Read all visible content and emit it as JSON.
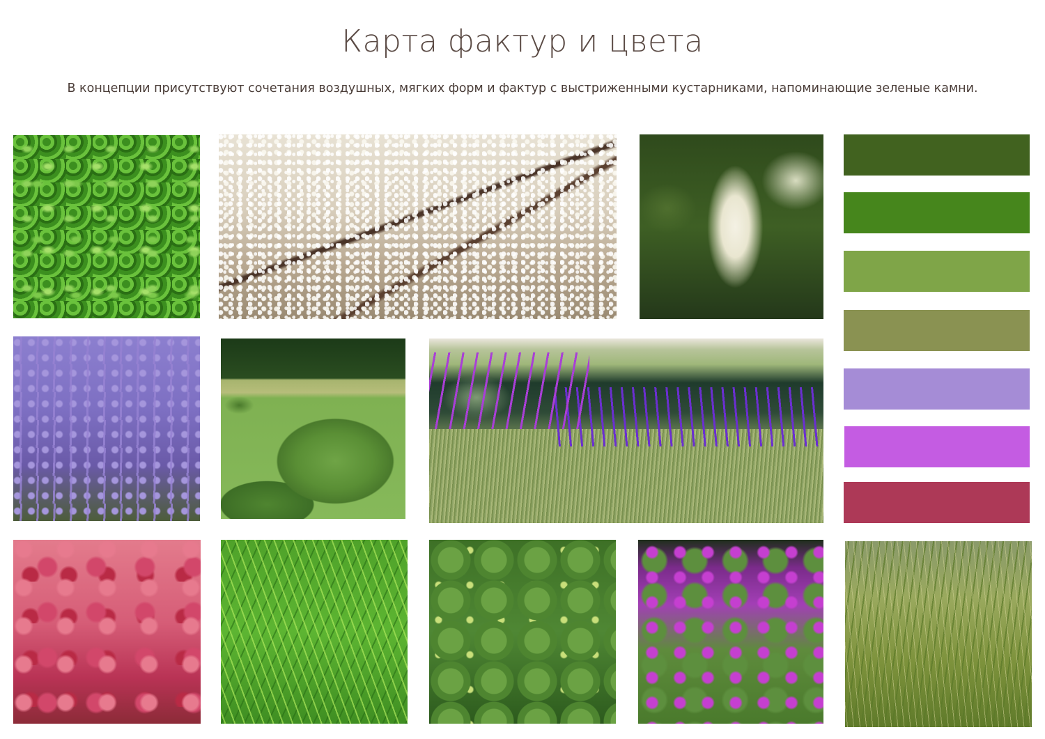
{
  "header": {
    "title": "Карта фактур и цвета",
    "subtitle": "В концепции присутствуют сочетания воздушных, мягких форм и фактур с выстриженными  кустарниками, напоминающие зеленые камни."
  },
  "palette": {
    "swatches": [
      {
        "color": "#41621f"
      },
      {
        "color": "#46861c"
      },
      {
        "color": "#7fa548"
      },
      {
        "color": "#8a9252"
      },
      {
        "color": "#a58cd6"
      },
      {
        "color": "#c45ce2"
      },
      {
        "color": "#ad3957"
      }
    ]
  },
  "photos": [
    {
      "subject": "glossy-green-shrub-foliage"
    },
    {
      "subject": "white-blossoming-tree"
    },
    {
      "subject": "white-astilbe-plume"
    },
    {
      "subject": "purple-catmint-flowers"
    },
    {
      "subject": "clipped-topiary-mounds"
    },
    {
      "subject": "garden-with-pond-salvia-grasses"
    },
    {
      "subject": "pink-sedum-flowers"
    },
    {
      "subject": "lawn-grass-texture"
    },
    {
      "subject": "lady-mantle-leaves"
    },
    {
      "subject": "magenta-geranium-flowers"
    },
    {
      "subject": "ornamental-grass"
    }
  ]
}
